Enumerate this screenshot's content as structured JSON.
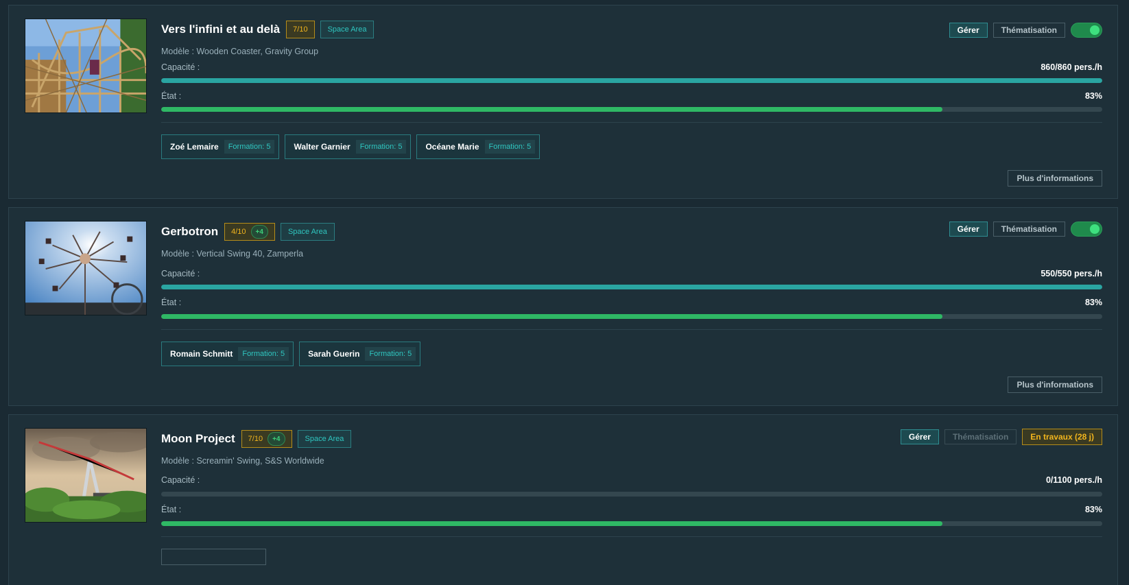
{
  "labels": {
    "model_prefix": "Modèle :",
    "capacity": "Capacité :",
    "state": "État :",
    "manage": "Gérer",
    "theme": "Thématisation",
    "more_info": "Plus d'informations"
  },
  "rides": [
    {
      "name": "Vers l'infini et au delà",
      "rating": "7/10",
      "boost": "",
      "area": "Space Area",
      "model": "Wooden Coaster, Gravity Group",
      "capacity_text": "860/860 pers./h",
      "capacity_fraction": 1.0,
      "state_text": "83%",
      "state_fraction": 0.83,
      "toggle_on": true,
      "status_badge": "",
      "staff": [
        {
          "name": "Zoé Lemaire",
          "training": "Formation: 5"
        },
        {
          "name": "Walter Garnier",
          "training": "Formation: 5"
        },
        {
          "name": "Océane Marie",
          "training": "Formation: 5"
        }
      ],
      "image": "wooden-coaster-photo"
    },
    {
      "name": "Gerbotron",
      "rating": "4/10",
      "boost": "+4",
      "area": "Space Area",
      "model": "Vertical Swing 40, Zamperla",
      "capacity_text": "550/550 pers./h",
      "capacity_fraction": 1.0,
      "state_text": "83%",
      "state_fraction": 0.83,
      "toggle_on": true,
      "status_badge": "",
      "staff": [
        {
          "name": "Romain Schmitt",
          "training": "Formation: 5"
        },
        {
          "name": "Sarah Guerin",
          "training": "Formation: 5"
        }
      ],
      "image": "swing-ride-photo"
    },
    {
      "name": "Moon Project",
      "rating": "7/10",
      "boost": "+4",
      "area": "Space Area",
      "model": "Screamin' Swing, S&S Worldwide",
      "capacity_text": "0/1100 pers./h",
      "capacity_fraction": 0.0,
      "state_text": "83%",
      "state_fraction": 0.83,
      "toggle_on": false,
      "status_badge": "En travaux (28 j)",
      "staff": [],
      "image": "pendulum-swing-photo"
    }
  ],
  "colors": {
    "background": "#1a2a33",
    "card": "#1e3039",
    "teal": "#2aa5a2",
    "green": "#2fb865",
    "gold": "#f2b51d"
  }
}
